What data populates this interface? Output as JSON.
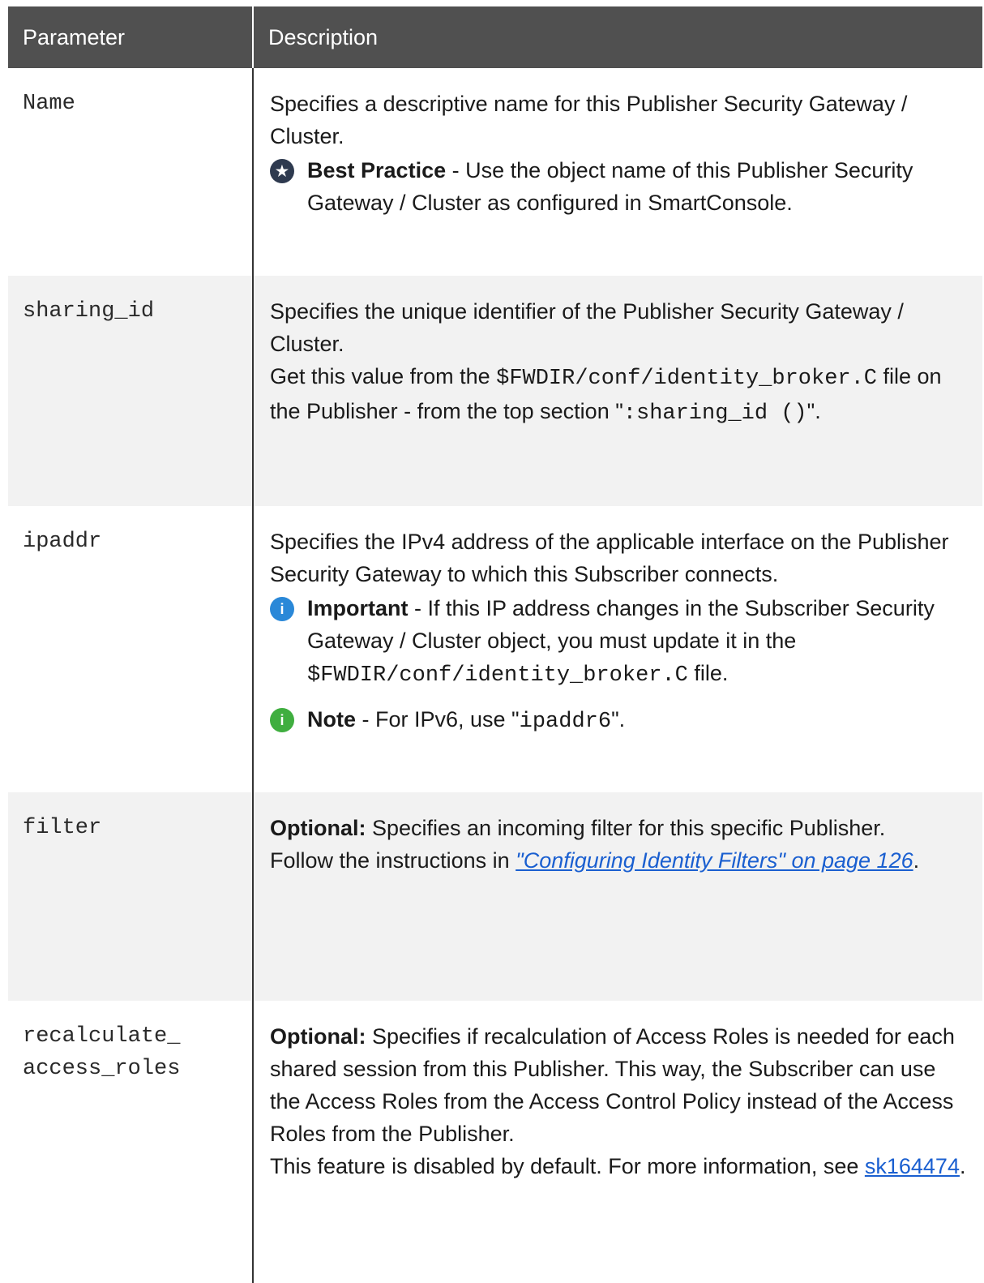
{
  "table": {
    "headers": {
      "parameter": "Parameter",
      "description": "Description"
    },
    "rows": {
      "name": {
        "param": "Name",
        "desc": "Specifies a descriptive name for this Publisher Security Gateway / Cluster.",
        "bp_label": "Best Practice",
        "bp_text": " - Use the object name of this Publisher Security Gateway / Cluster as configured in SmartConsole."
      },
      "sharing_id": {
        "param": "sharing_id",
        "desc": "Specifies the unique identifier of the Publisher Security Gateway / Cluster.",
        "get_pre": "Get this value from the ",
        "get_code": "$FWDIR/conf/identity_broker.C",
        "get_post": " file on the Publisher - from the top section \"",
        "get_code2": ":sharing_id ()",
        "get_end": "\"."
      },
      "ipaddr": {
        "param": "ipaddr",
        "desc": "Specifies the IPv4 address of the applicable interface on the Publisher Security Gateway to which this Subscriber connects.",
        "imp_label": "Important",
        "imp_text": " - If this IP address changes in the Subscriber Security Gateway / Cluster object, you must update it in the ",
        "imp_code": "$FWDIR/conf/identity_broker.C",
        "imp_end": " file.",
        "note_label": "Note",
        "note_text": " - For IPv6, use \"",
        "note_code": "ipaddr6",
        "note_end": "\"."
      },
      "filter": {
        "param": "filter",
        "opt_label": "Optional:",
        "desc": " Specifies an incoming filter for this specific Publisher.",
        "follow_pre": "Follow the instructions in ",
        "follow_link": "\"Configuring Identity Filters\" on page 126",
        "follow_end": "."
      },
      "recalc": {
        "param_l1": "recalculate_",
        "param_l2": "access_roles",
        "opt_label": "Optional:",
        "desc": " Specifies if recalculation of Access Roles is needed for each shared session from this Publisher. This way, the Subscriber can use the Access Roles from the Access Control Policy instead of the Access Roles from the Publisher.",
        "feature_pre": "This feature is disabled by default. For more information, see ",
        "feature_link": "sk164474",
        "feature_end": "."
      }
    }
  }
}
